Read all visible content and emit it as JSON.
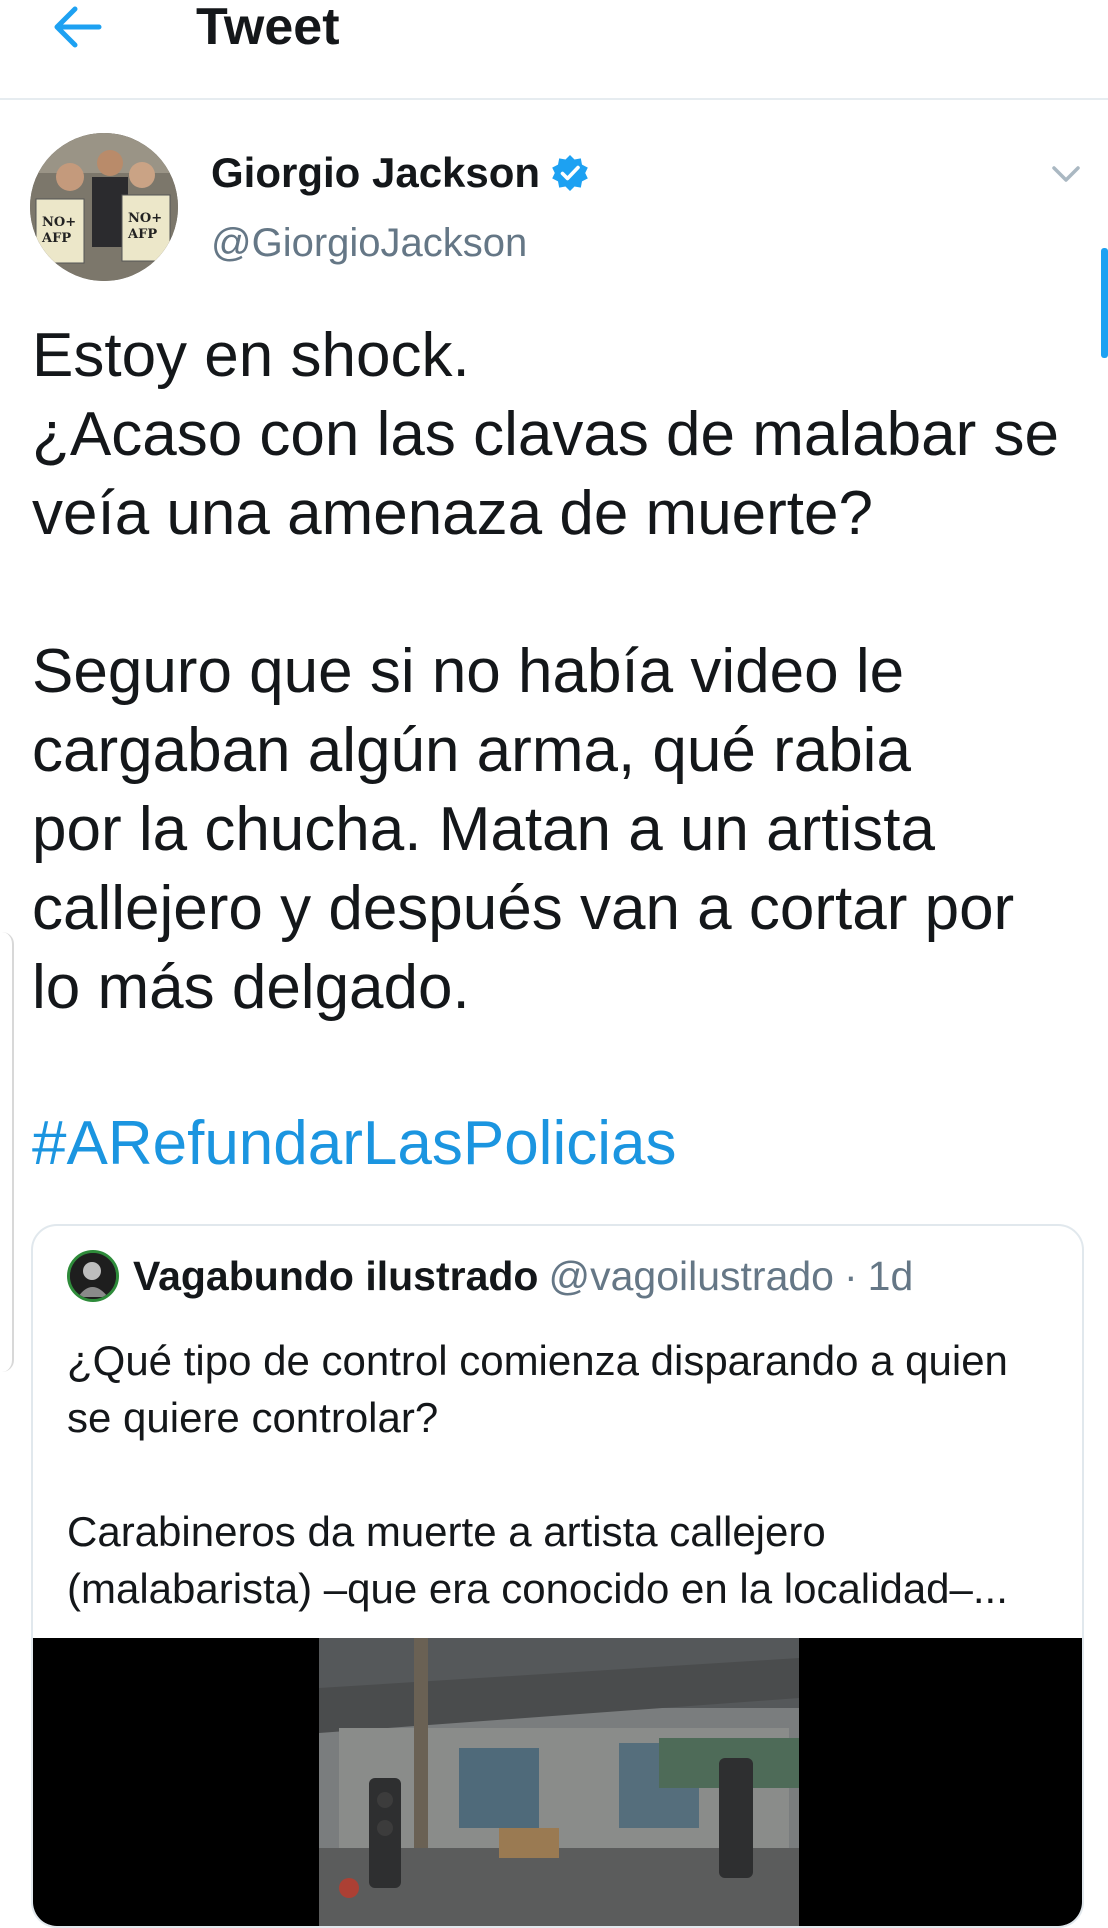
{
  "header": {
    "title": "Tweet",
    "back_icon": "arrow-left-icon"
  },
  "colors": {
    "accent": "#1da1f2",
    "link": "#1b95e0",
    "text": "#14171a",
    "secondary": "#657786",
    "divider": "#e6ecf0"
  },
  "tweet": {
    "author": {
      "name": "Giorgio Jackson",
      "handle": "@GiorgioJackson",
      "verified": true,
      "avatar_sign_text": "NO+ AFP"
    },
    "body_paragraph_1": "Estoy en shock.\n¿Acaso con las clavas de malabar se veía una amenaza de muerte?",
    "body_line_1": "Estoy en shock.",
    "body_line_2": "¿Acaso con las clavas de malabar se",
    "body_line_3": "veía una amenaza de muerte?",
    "body_line_4": "Seguro que si no había video le",
    "body_line_5": "cargaban algún arma, qué rabia",
    "body_line_6": "por la chucha. Matan a un artista",
    "body_line_7": "callejero y después van a cortar por",
    "body_line_8": "lo más delgado.",
    "hashtag": "#ARefundarLasPolicias"
  },
  "quoted_tweet": {
    "name": "Vagabundo ilustrado",
    "handle": "@vagoilustrado",
    "separator": "·",
    "time": "1d",
    "line_1": "¿Qué tipo de control comienza disparando a quien",
    "line_2": "se quiere controlar?",
    "line_3": "Carabineros da muerte a artista callejero",
    "line_4": "(malabarista) –que era conocido en la localidad–..."
  }
}
